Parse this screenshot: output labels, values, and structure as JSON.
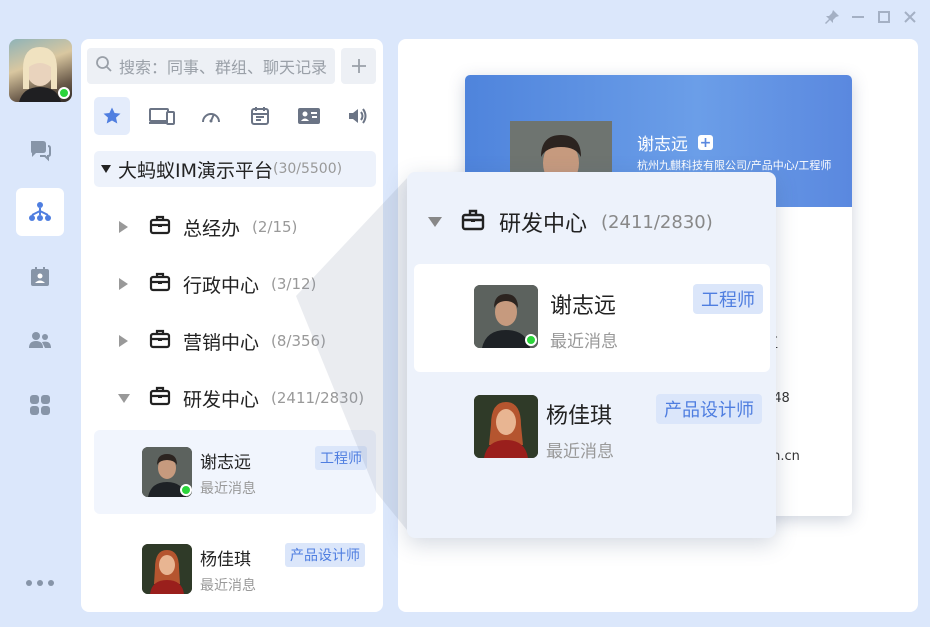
{
  "window": {
    "controls": [
      "pin-icon",
      "minimize-icon",
      "maximize-icon",
      "close-icon"
    ]
  },
  "rail": {
    "items": [
      "chat-icon",
      "org-icon",
      "calendar-icon",
      "contacts-icon",
      "apps-icon",
      "more-icon"
    ],
    "active": "org-icon"
  },
  "search": {
    "placeholder": "搜索：同事、群组、聊天记录",
    "add_label": "+"
  },
  "tabs": [
    "star-icon",
    "device-icon",
    "dashboard-icon",
    "calendar-icon",
    "contact-card-icon",
    "speaker-icon"
  ],
  "org": {
    "root_name": "大蚂蚁IM演示平台",
    "root_count": "(30/5500)",
    "departments": [
      {
        "name": "总经办",
        "count": "(2/15)",
        "expanded": false
      },
      {
        "name": "行政中心",
        "count": "(3/12)",
        "expanded": false
      },
      {
        "name": "营销中心",
        "count": "(8/356)",
        "expanded": false
      },
      {
        "name": "研发中心",
        "count": "(2411/2830)",
        "expanded": true
      }
    ],
    "members": [
      {
        "name": "谢志远",
        "sub": "最近消息",
        "tag": "工程师",
        "online": true
      },
      {
        "name": "杨佳琪",
        "sub": "最近消息",
        "tag": "产品设计师",
        "online": false
      }
    ]
  },
  "card": {
    "name": "谢志远",
    "plus": "+",
    "path": "杭州九麒科技有限公司/产品中心/工程师",
    "partial_lines": [
      "区",
      "8",
      "748",
      "ch.cn"
    ]
  },
  "popup": {
    "dept_name": "研发中心",
    "dept_count": "(2411/2830)",
    "members": [
      {
        "name": "谢志远",
        "sub": "最近消息",
        "tag": "工程师"
      },
      {
        "name": "杨佳琪",
        "sub": "最近消息",
        "tag": "产品设计师"
      }
    ]
  },
  "colors": {
    "accent": "#4f7ee0",
    "online": "#2bd43a",
    "background": "#dbe7fb",
    "selected": "#edf2fb"
  }
}
